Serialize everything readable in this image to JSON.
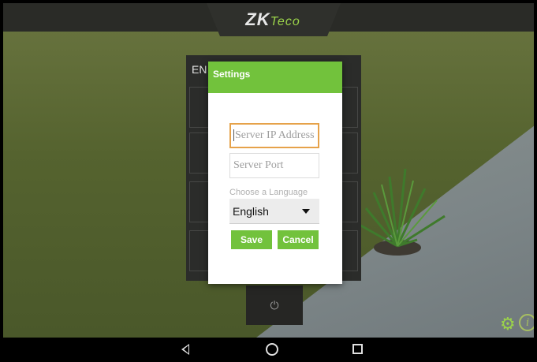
{
  "header": {
    "logo_main": "ZK",
    "logo_tail": "Teco"
  },
  "background": {
    "enter_label_fragment": "EN"
  },
  "dialog": {
    "title": "Settings",
    "server_ip_placeholder": "Server IP Address",
    "server_port_placeholder": "Server Port",
    "language_label": "Choose a Language",
    "language_selected": "English",
    "save_label": "Save",
    "cancel_label": "Cancel"
  },
  "icons": {
    "power": "power-icon",
    "gear": "gear-icon",
    "info": "info-icon",
    "back": "back-icon",
    "home": "home-icon",
    "recents": "recents-icon"
  },
  "colors": {
    "accent": "#72c23c",
    "focus": "#e6a24a"
  }
}
